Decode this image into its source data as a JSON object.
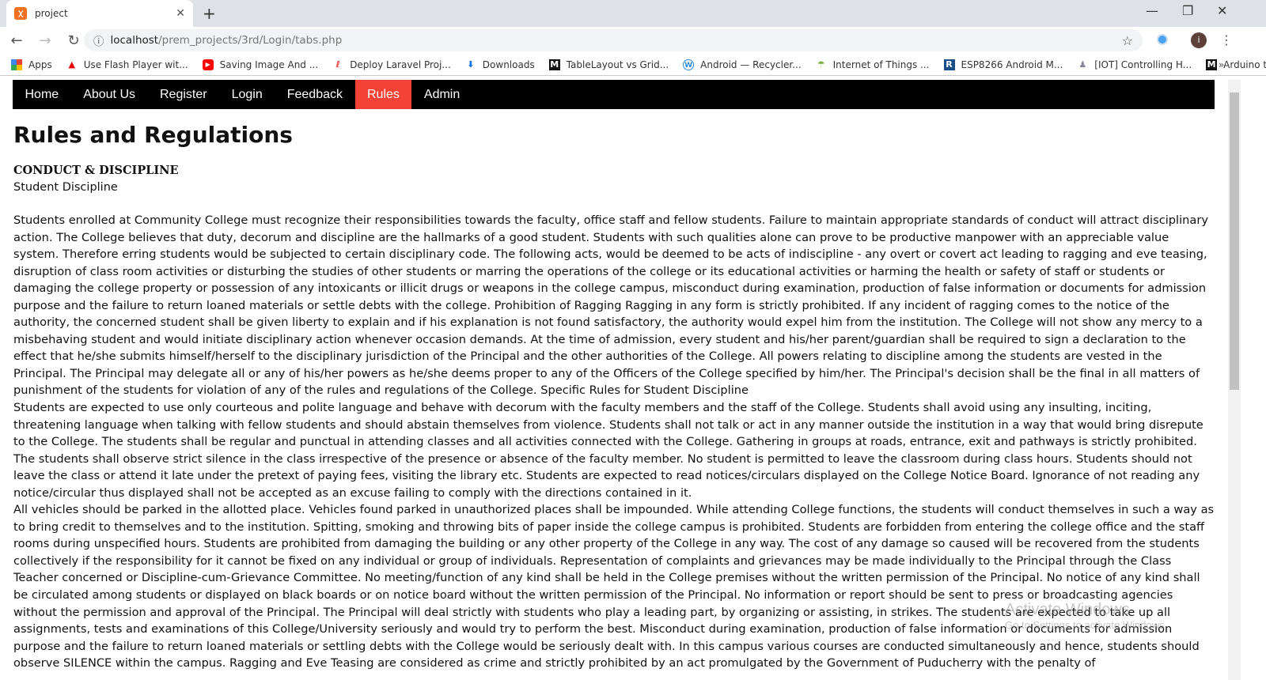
{
  "browser": {
    "tab_title": "project",
    "url_host": "localhost",
    "url_path": "/prem_projects/3rd/Login/tabs.php",
    "bookmarks": [
      "Apps",
      "Use Flash Player wit...",
      "Saving Image And ...",
      "Deploy Laravel Proj...",
      "Downloads",
      "TableLayout vs Grid...",
      "Android — Recycler...",
      "Internet of Things ...",
      "ESP8266 Android M...",
      "[IOT] Controlling H...",
      "Arduino to Android..."
    ],
    "profile_initial": "i"
  },
  "nav": {
    "items": [
      "Home",
      "About Us",
      "Register",
      "Login",
      "Feedback",
      "Rules",
      "Admin"
    ],
    "active": "Rules",
    "active_color": "#f44336"
  },
  "page": {
    "title": "Rules and Regulations",
    "section_heading": "CONDUCT & DISCIPLINE",
    "section_sub": "Student Discipline",
    "paragraphs": [
      "Students enrolled at Community College must recognize their responsibilities towards the faculty, office staff and fellow students. Failure to maintain appropriate standards of conduct will attract disciplinary action. The College believes that duty, decorum and discipline are the hallmarks of a good student. Students with such qualities alone can prove to be productive manpower with an appreciable value system. Therefore erring students would be subjected to certain disciplinary code. The following acts, would be deemed to be acts of indiscipline - any overt or covert act leading to ragging and eve teasing, disruption of class room activities or disturbing the studies of other students or marring the operations of the college or its educational activities or harming the health or safety of staff or students or damaging the college property or possession of any intoxicants or illicit drugs or weapons in the college campus, misconduct during examination, production of false information or documents for admission purpose and the failure to return loaned materials or settle debts with the college. Prohibition of Ragging Ragging in any form is strictly prohibited. If any incident of ragging comes to the notice of the authority, the concerned student shall be given liberty to explain and if his explanation is not found satisfactory, the authority would expel him from the institution. The College will not show any mercy to a misbehaving student and would initiate disciplinary action whenever occasion demands. At the time of admission, every student and his/her parent/guardian shall be required to sign a declaration to the effect that he/she submits himself/herself to the disciplinary jurisdiction of the Principal and the other authorities of the College. All powers relating to discipline among the students are vested in the Principal. The Principal may delegate all or any of his/her powers as he/she deems proper to any of the Officers of the College specified by him/her. The Principal's decision shall be the final in all matters of punishment of the students for violation of any of the rules and regulations of the College. Specific Rules for Student Discipline",
      "Students are expected to use only courteous and polite language and behave with decorum with the faculty members and the staff of the College. Students shall avoid using any insulting, inciting, threatening language when talking with fellow students and should abstain themselves from violence. Students shall not talk or act in any manner outside the institution in a way that would bring disrepute to the College. The students shall be regular and punctual in attending classes and all activities connected with the College. Gathering in groups at roads, entrance, exit and pathways is strictly prohibited. The students shall observe strict silence in the class irrespective of the presence or absence of the faculty member. No student is permitted to leave the classroom during class hours. Students should not leave the class or attend it late under the pretext of paying fees, visiting the library etc. Students are expected to read notices/circulars displayed on the College Notice Board. Ignorance of not reading any notice/circular thus displayed shall not be accepted as an excuse failing to comply with the directions contained in it.",
      "All vehicles should be parked in the allotted place. Vehicles found parked in unauthorized places shall be impounded. While attending College functions, the students will conduct themselves in such a way as to bring credit to themselves and to the institution. Spitting, smoking and throwing bits of paper inside the college campus is prohibited. Students are forbidden from entering the college office and the staff rooms during unspecified hours. Students are prohibited from damaging the building or any other property of the College in any way. The cost of any damage so caused will be recovered from the students collectively if the responsibility for it cannot be fixed on any individual or group of individuals. Representation of complaints and grievances may be made individually to the Principal through the Class Teacher concerned or Discipline-cum-Grievance Committee. No meeting/function of any kind shall be held in the College premises without the written permission of the Principal. No notice of any kind shall be circulated among students or displayed on black boards or on notice board without the written permission of the Principal. No information or report should be sent to press or broadcasting agencies without the permission and approval of the Principal. The Principal will deal strictly with students who play a leading part, by organizing or assisting, in strikes. The students are expected to take up all assignments, tests and examinations of this College/University seriously and would try to perform the best. Misconduct during examination, production of false information or documents for admission purpose and the failure to return loaned materials or settling debts with the College would be seriously dealt with. In this campus various courses are conducted simultaneously and hence, students should observe SILENCE within the campus. Ragging and Eve Teasing are considered as crime and strictly prohibited by an act promulgated by the Government of Puducherry with the penalty of"
    ]
  },
  "watermark": {
    "line1": "Activate Windows",
    "line2": "Go to Settings to activate Windows."
  }
}
